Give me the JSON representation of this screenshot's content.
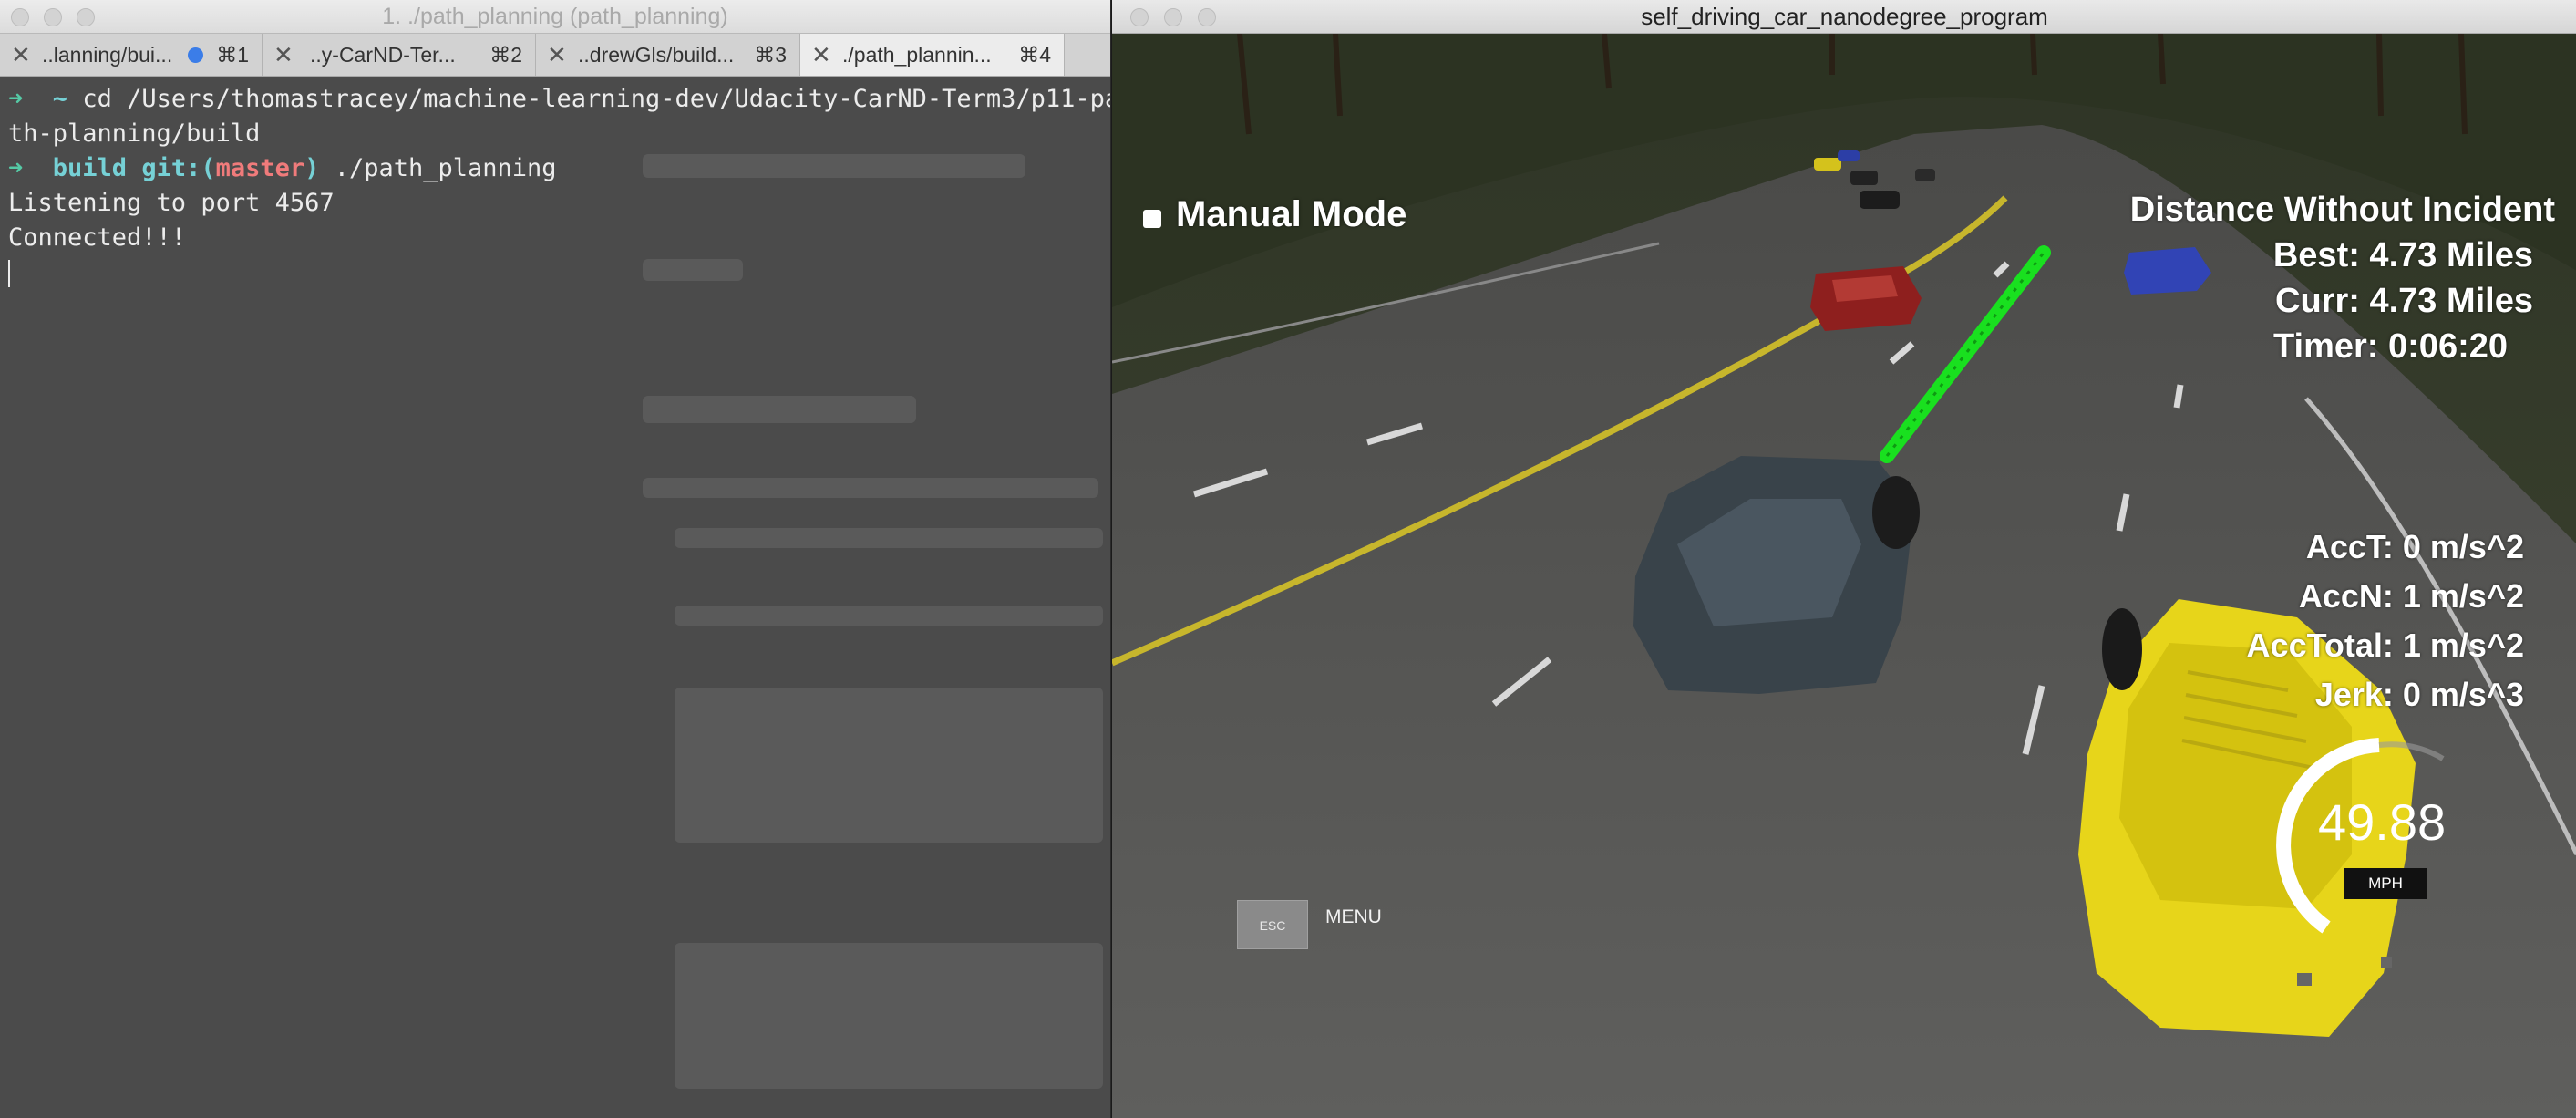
{
  "terminal": {
    "window_title": "1. ./path_planning (path_planning)",
    "tabs": [
      {
        "label": "..lanning/bui...",
        "shortcut": "⌘1",
        "has_dot": true
      },
      {
        "label": "..y-CarND-Ter...",
        "shortcut": "⌘2",
        "has_dot": false
      },
      {
        "label": "..drewGls/build...",
        "shortcut": "⌘3",
        "has_dot": false
      },
      {
        "label": "./path_plannin...",
        "shortcut": "⌘4",
        "has_dot": false,
        "active": true
      }
    ],
    "lines": {
      "l1_prompt": "➜",
      "l1_tilde": "~",
      "l1_cmd": "cd /Users/thomastracey/machine-learning-dev/Udacity-CarND-Term3/p11-pa",
      "l2": "th-planning/build",
      "l3_prompt": "➜",
      "l3_dir": "build",
      "l3_git": "git:(",
      "l3_branch": "master",
      "l3_close": ")",
      "l3_cmd": "./path_planning",
      "l4": "Listening to port 4567",
      "l5": "Connected!!!"
    }
  },
  "simulator": {
    "window_title": "self_driving_car_nanodegree_program",
    "hud": {
      "manual_mode": "Manual Mode",
      "distance_title": "Distance Without Incident",
      "best": "Best: 4.73 Miles",
      "curr": "Curr: 4.73 Miles",
      "timer": "Timer: 0:06:20",
      "acc_t": "AccT: 0 m/s^2",
      "acc_n": "AccN: 1 m/s^2",
      "acc_total": "AccTotal: 1 m/s^2",
      "jerk": "Jerk: 0 m/s^3",
      "speed": "49.88",
      "speed_unit": "MPH",
      "speed_fraction": 0.5,
      "esc_key": "ESC",
      "menu": "MENU"
    },
    "colors": {
      "path_green": "#19e01f",
      "ego_yellow": "#e7d51a",
      "lane_yellow": "#c7b62c"
    }
  }
}
